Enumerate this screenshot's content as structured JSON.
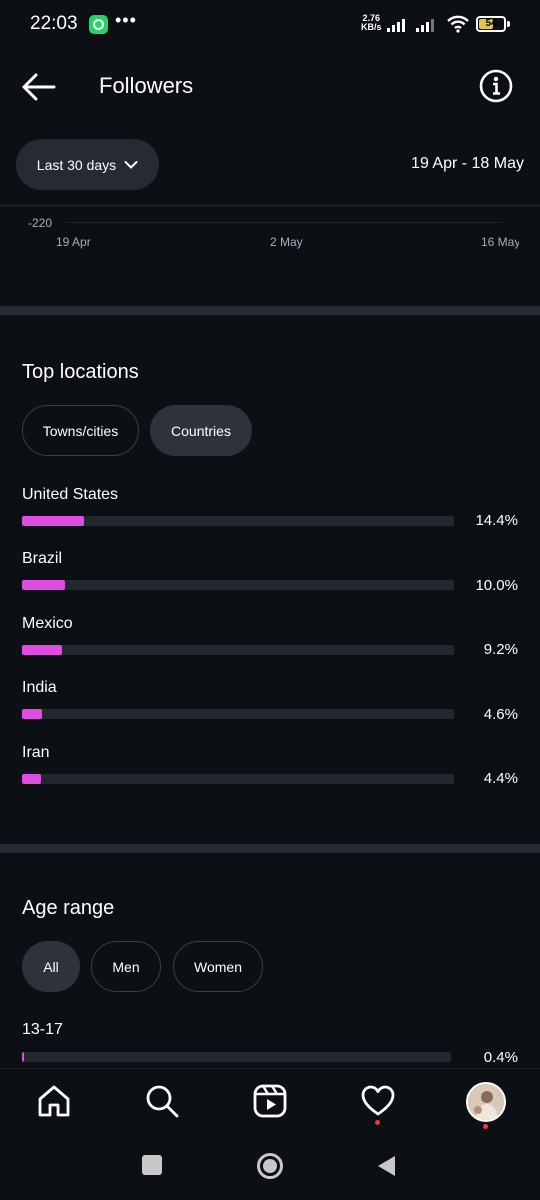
{
  "status_bar": {
    "time": "22:03",
    "speed_value": "2.76",
    "speed_unit": "KB/s",
    "battery": "54",
    "icons": [
      "whatsapp-icon",
      "more-dots-icon",
      "signal-icon",
      "wifi-icon",
      "battery-icon"
    ]
  },
  "header": {
    "title": "Followers",
    "back_icon": "arrow-left-icon",
    "info_icon": "info-icon"
  },
  "filter": {
    "range_label": "Last 30 days",
    "date_range": "19 Apr - 18 May"
  },
  "chart": {
    "y_tick": "-220",
    "x_ticks": [
      "19 Apr",
      "2 May",
      "16 May"
    ]
  },
  "top_locations": {
    "title": "Top locations",
    "tabs": [
      {
        "label": "Towns/cities",
        "selected": false
      },
      {
        "label": "Countries",
        "selected": true
      }
    ],
    "rows": [
      {
        "label": "United States",
        "value": "14.4%",
        "fraction": 0.144
      },
      {
        "label": "Brazil",
        "value": "10.0%",
        "fraction": 0.1
      },
      {
        "label": "Mexico",
        "value": "9.2%",
        "fraction": 0.092
      },
      {
        "label": "India",
        "value": "4.6%",
        "fraction": 0.046
      },
      {
        "label": "Iran",
        "value": "4.4%",
        "fraction": 0.044
      }
    ]
  },
  "age_range": {
    "title": "Age range",
    "tabs": [
      {
        "label": "All",
        "selected": true
      },
      {
        "label": "Men",
        "selected": false
      },
      {
        "label": "Women",
        "selected": false
      }
    ],
    "rows": [
      {
        "label": "13-17",
        "value": "0.4%",
        "fraction": 0.004
      }
    ]
  },
  "bottom_nav": {
    "items": [
      "home-icon",
      "search-icon",
      "reels-icon",
      "heart-icon",
      "profile-avatar"
    ]
  },
  "colors": {
    "background": "#0c0f14",
    "bar_fill": "#e04be0",
    "bar_track": "#23272f",
    "notification_dot": "#ff3040"
  }
}
